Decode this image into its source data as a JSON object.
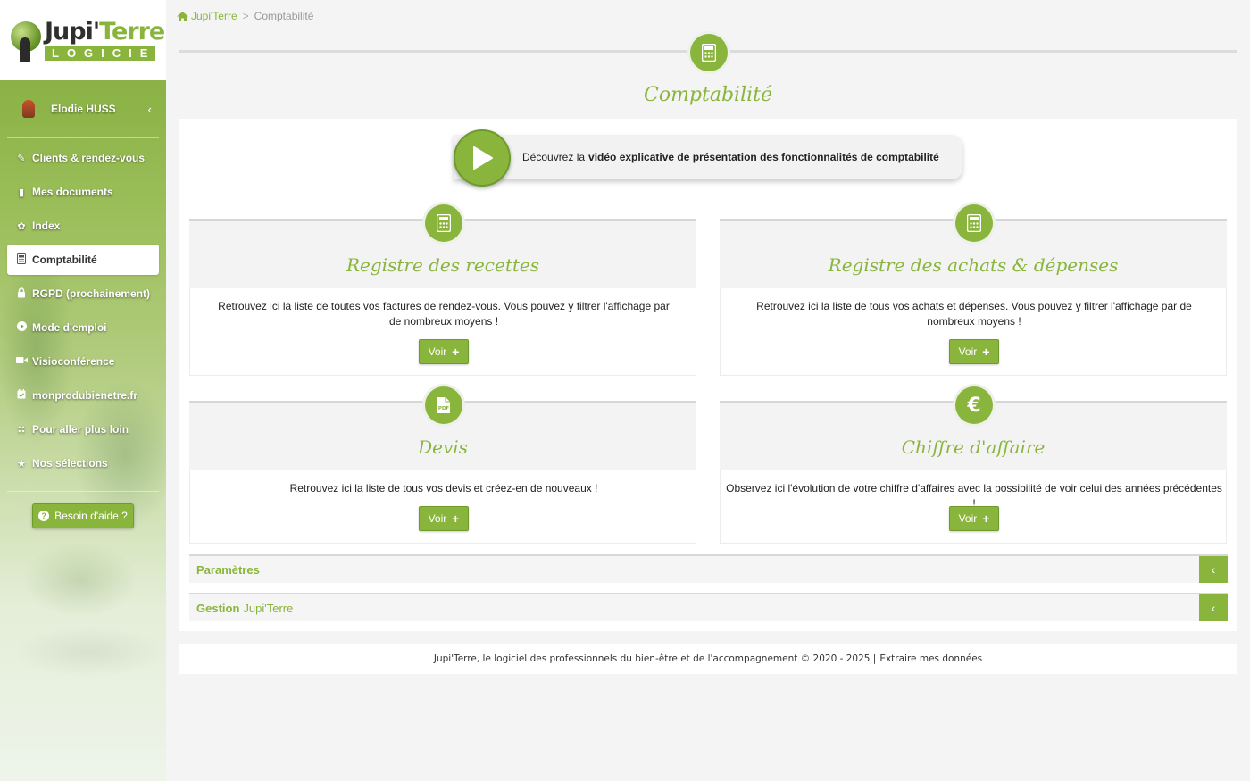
{
  "brand": {
    "title_a": "Jupi'",
    "title_b": "Terre",
    "subtitle": "LOGICIEL",
    "accent_color": "#8ab53d"
  },
  "user": {
    "name": "Elodie HUSS"
  },
  "sidebar": {
    "items": [
      {
        "label": "Clients & rendez-vous",
        "icon": "pencil-icon"
      },
      {
        "label": "Mes documents",
        "icon": "document-icon"
      },
      {
        "label": "Index",
        "icon": "leaf-icon"
      },
      {
        "label": "Comptabilité",
        "icon": "calculator-icon",
        "active": true
      },
      {
        "label": "RGPD (prochainement)",
        "icon": "lock-icon"
      },
      {
        "label": "Mode d'emploi",
        "icon": "play-circle-icon"
      },
      {
        "label": "Visioconférence",
        "icon": "video-camera-icon"
      },
      {
        "label": "monprodubienetre.fr",
        "icon": "calendar-check-icon"
      },
      {
        "label": "Pour aller plus loin",
        "icon": "graduation-icon"
      },
      {
        "label": "Nos sélections",
        "icon": "star-icon"
      }
    ],
    "help_label": "Besoin d'aide ?"
  },
  "breadcrumb": {
    "home": "Jupi'Terre",
    "separator": ">",
    "current": "Comptabilité"
  },
  "page": {
    "title": "Comptabilité"
  },
  "video": {
    "prefix": "Découvrez la",
    "bold": "vidéo explicative de présentation des fonctionnalités de comptabilité"
  },
  "cards": [
    {
      "title": "Registre des recettes",
      "text": "Retrouvez ici la liste de toutes vos factures de rendez-vous. Vous pouvez y filtrer l'affichage par de nombreux moyens !",
      "button": "Voir",
      "icon": "calculator-icon"
    },
    {
      "title": "Registre des achats & dépenses",
      "text": "Retrouvez ici la liste de tous vos achats et dépenses. Vous pouvez y filtrer l'affichage par de nombreux moyens !",
      "button": "Voir",
      "icon": "calculator-icon"
    },
    {
      "title": "Devis",
      "text": "Retrouvez ici la liste de tous vos devis et créez-en de nouveaux !",
      "button": "Voir",
      "icon": "pdf-icon"
    },
    {
      "title": "Chiffre d'affaire",
      "text": "Observez ici l'évolution de votre chiffre d'affaires avec la possibilité de voir celui des années précédentes !",
      "button": "Voir",
      "icon": "euro-icon"
    }
  ],
  "accordions": [
    {
      "label_bold": "Paramètres",
      "label_rest": ""
    },
    {
      "label_bold": "Gestion",
      "label_rest": "Jupi'Terre"
    }
  ],
  "footer": {
    "text": "Jupi'Terre, le logiciel des professionnels du bien-être et de l'accompagnement © 2020 - 2025 |",
    "link": "Extraire mes données"
  }
}
